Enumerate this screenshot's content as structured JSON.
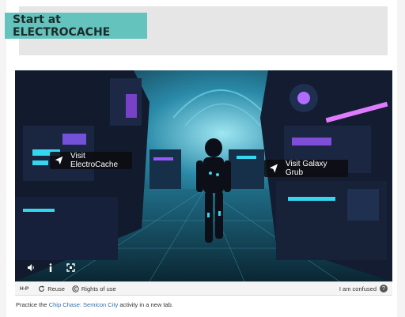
{
  "header": {
    "title": "Start at ELECTROCACHE"
  },
  "hotspots": [
    {
      "label": "Visit ElectroCache",
      "icon": "navigation-arrow-icon"
    },
    {
      "label": "Visit Galaxy Grub",
      "icon": "navigation-arrow-icon"
    }
  ],
  "player_controls": {
    "audio_icon": "volume-icon",
    "info_icon": "info-icon",
    "fullscreen_icon": "fullscreen-icon"
  },
  "footer": {
    "brand": "H-P",
    "reuse_label": "Reuse",
    "rights_label": "Rights of use",
    "confused_label": "I am confused"
  },
  "practice": {
    "prefix": "Practice the ",
    "link": "Chip Chase: Semicon City",
    "suffix": " activity in a new tab."
  },
  "colors": {
    "accent": "#64c3bd",
    "link": "#2f6fa8",
    "neon_cyan": "#35d6f0",
    "neon_purple": "#a04cff"
  }
}
